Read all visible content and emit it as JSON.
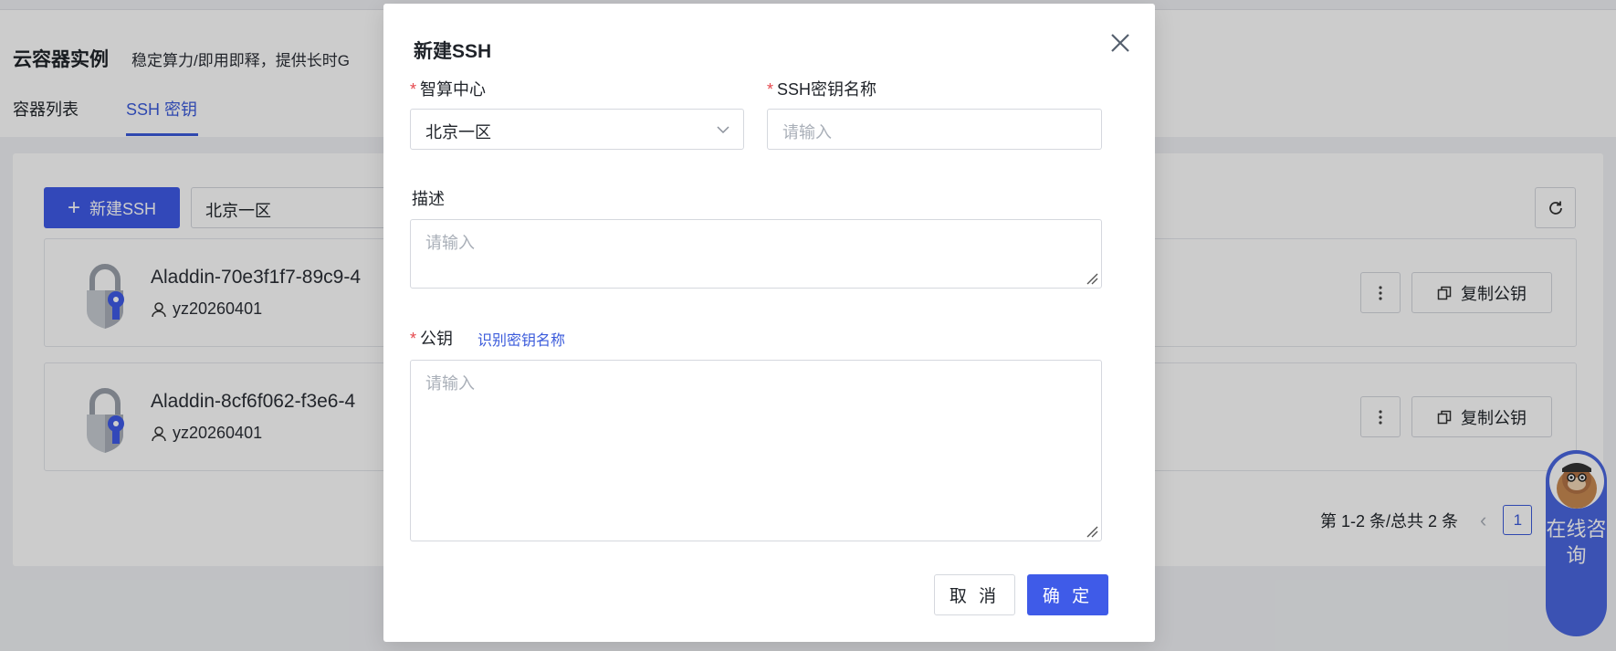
{
  "page": {
    "title": "云容器实例",
    "subtitle": "稳定算力/即用即释，提供长时G",
    "tabs": [
      {
        "label": "容器列表"
      },
      {
        "label": "SSH 密钥"
      }
    ],
    "toolbar": {
      "new_button_label": "新建SSH",
      "region_value": "北京一区"
    },
    "keys": [
      {
        "name": "Aladdin-70e3f1f7-89c9-4",
        "user": "yz20260401",
        "copy_label": "复制公钥"
      },
      {
        "name": "Aladdin-8cf6f062-f3e6-4",
        "user": "yz20260401",
        "copy_label": "复制公钥"
      }
    ],
    "pagination": {
      "summary": "第 1-2 条/总共 2 条",
      "current_page": "1"
    },
    "help_widget": {
      "label": "在线咨询"
    }
  },
  "modal": {
    "title": "新建SSH",
    "fields": {
      "center": {
        "label": "智算中心",
        "value": "北京一区",
        "required": true
      },
      "key_name": {
        "label": "SSH密钥名称",
        "placeholder": "请输入",
        "required": true
      },
      "description": {
        "label": "描述",
        "placeholder": "请输入",
        "required": false
      },
      "public_key": {
        "label": "公钥",
        "placeholder": "请输入",
        "required": true,
        "helper_link": "识别密钥名称"
      }
    },
    "buttons": {
      "cancel": "取 消",
      "confirm": "确 定"
    }
  },
  "colors": {
    "primary": "#3f5be8",
    "link": "#3b5bdb",
    "required": "#e5484d"
  }
}
